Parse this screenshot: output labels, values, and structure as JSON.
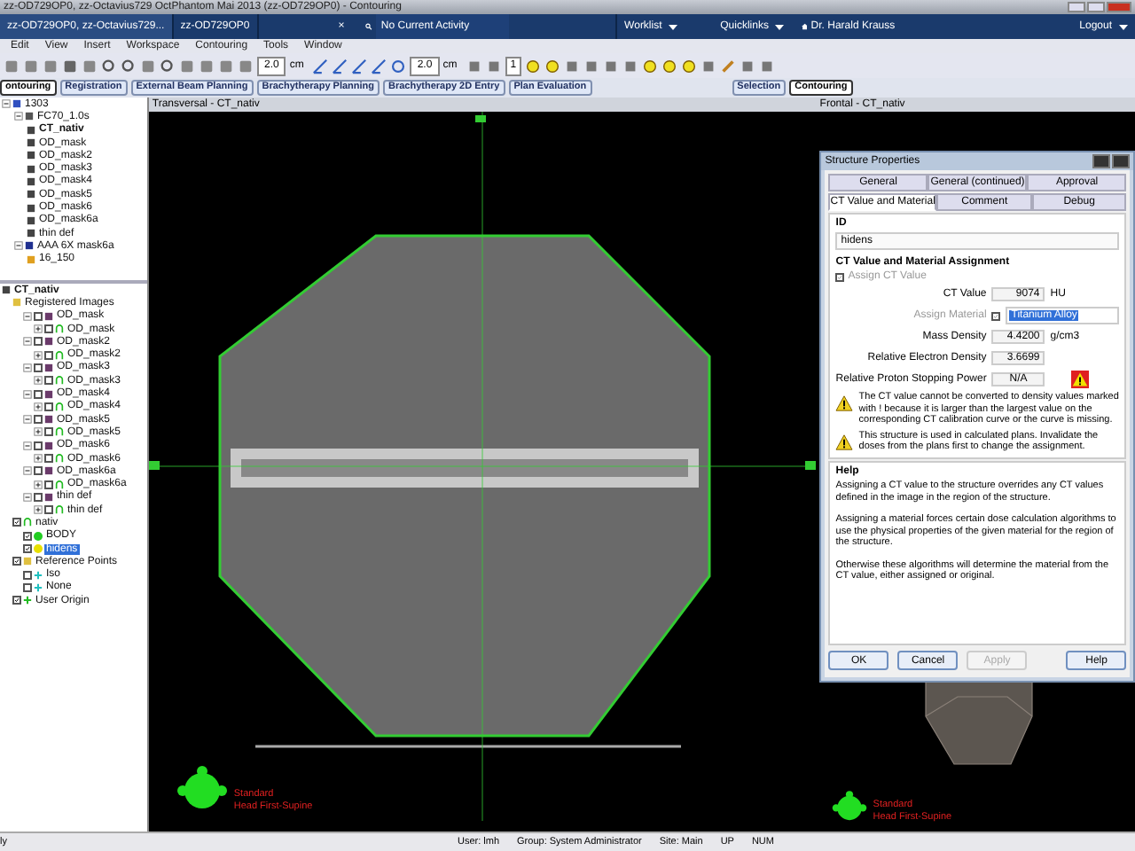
{
  "window": {
    "title": "zz-OD729OP0, zz-Octavius729 OctPhantom Mai 2013 (zz-OD729OP0) - Contouring"
  },
  "header_bar": {
    "tabs": [
      {
        "label": "zz-OD729OP0, zz-Octavius729...",
        "selected": true
      },
      {
        "label": "zz-OD729OP0",
        "selected": false
      }
    ],
    "close": "×",
    "activity": "No Current Activity",
    "worklist": "Worklist",
    "quicklinks": "Quicklinks",
    "user": "Dr. Harald Krauss",
    "logout": "Logout"
  },
  "menu": [
    "Edit",
    "View",
    "Insert",
    "Workspace",
    "Contouring",
    "Tools",
    "Window"
  ],
  "toolbar": {
    "fields": [
      {
        "value": "2.0",
        "unit": "cm"
      },
      {
        "value": "2.0",
        "unit": "cm"
      },
      {
        "value": "1"
      }
    ]
  },
  "workspaces": [
    {
      "label": "ontouring",
      "selected": true
    },
    {
      "label": "Registration",
      "selected": false
    },
    {
      "label": "External Beam Planning",
      "selected": false
    },
    {
      "label": "Brachytherapy Planning",
      "selected": false
    },
    {
      "label": "Brachytherapy 2D Entry",
      "selected": false
    },
    {
      "label": "Plan Evaluation",
      "selected": false
    }
  ],
  "modes": [
    {
      "label": "Selection",
      "selected": false
    },
    {
      "label": "Contouring",
      "selected": true
    }
  ],
  "scope_tree": [
    {
      "label": "1303",
      "kind": "study",
      "expanded": true,
      "children": [
        {
          "label": "FC70_1.0s",
          "kind": "series",
          "expanded": true,
          "children": [
            {
              "label": "CT_nativ",
              "kind": "image"
            },
            {
              "label": "OD_mask",
              "kind": "image"
            },
            {
              "label": "OD_mask2",
              "kind": "image"
            },
            {
              "label": "OD_mask3",
              "kind": "image"
            },
            {
              "label": "OD_mask4",
              "kind": "image"
            },
            {
              "label": "OD_mask5",
              "kind": "image"
            },
            {
              "label": "OD_mask6",
              "kind": "image"
            },
            {
              "label": "OD_mask6a",
              "kind": "image"
            },
            {
              "label": "thin def",
              "kind": "image"
            }
          ]
        },
        {
          "label": "AAA 6X mask6a",
          "kind": "plan",
          "expanded": true,
          "children": [
            {
              "label": "16_150",
              "kind": "dose"
            }
          ]
        }
      ]
    }
  ],
  "focus_tree": [
    {
      "label": "CT_nativ",
      "kind": "image",
      "selected": false,
      "children": [
        {
          "label": "Registered Images",
          "kind": "folder",
          "selected": false,
          "children": [
            {
              "label": "OD_mask",
              "kind": "image-set",
              "expanded": true,
              "checked": false,
              "selected": false,
              "children": [
                {
                  "label": "OD_mask",
                  "kind": "structure-set",
                  "expanded": false,
                  "checked": false,
                  "selected": false
                }
              ]
            },
            {
              "label": "OD_mask2",
              "kind": "image-set",
              "expanded": true,
              "checked": false,
              "selected": false,
              "children": [
                {
                  "label": "OD_mask2",
                  "kind": "structure-set",
                  "expanded": false,
                  "checked": false,
                  "selected": false
                }
              ]
            },
            {
              "label": "OD_mask3",
              "kind": "image-set",
              "expanded": true,
              "checked": false,
              "selected": false,
              "children": [
                {
                  "label": "OD_mask3",
                  "kind": "structure-set",
                  "expanded": false,
                  "checked": false,
                  "selected": false
                }
              ]
            },
            {
              "label": "OD_mask4",
              "kind": "image-set",
              "expanded": true,
              "checked": false,
              "selected": false,
              "children": [
                {
                  "label": "OD_mask4",
                  "kind": "structure-set",
                  "expanded": false,
                  "checked": false,
                  "selected": false
                }
              ]
            },
            {
              "label": "OD_mask5",
              "kind": "image-set",
              "expanded": true,
              "checked": false,
              "selected": false,
              "children": [
                {
                  "label": "OD_mask5",
                  "kind": "structure-set",
                  "expanded": false,
                  "checked": false,
                  "selected": false
                }
              ]
            },
            {
              "label": "OD_mask6",
              "kind": "image-set",
              "expanded": true,
              "checked": false,
              "selected": false,
              "children": [
                {
                  "label": "OD_mask6",
                  "kind": "structure-set",
                  "expanded": false,
                  "checked": false,
                  "selected": false
                }
              ]
            },
            {
              "label": "OD_mask6a",
              "kind": "image-set",
              "expanded": true,
              "checked": false,
              "selected": false,
              "children": [
                {
                  "label": "OD_mask6a",
                  "kind": "structure-set",
                  "expanded": false,
                  "checked": false,
                  "selected": false
                }
              ]
            },
            {
              "label": "thin def",
              "kind": "image-set",
              "expanded": true,
              "checked": false,
              "selected": false,
              "children": [
                {
                  "label": "thin def",
                  "kind": "structure-set",
                  "expanded": false,
                  "checked": false,
                  "selected": false
                }
              ]
            }
          ]
        },
        {
          "label": "nativ",
          "kind": "structure-set",
          "checked": true,
          "selected": false,
          "children": [
            {
              "label": "BODY",
              "kind": "structure",
              "checked": true,
              "selected": false,
              "color": "#22cc22"
            },
            {
              "label": "hidens",
              "kind": "structure",
              "checked": true,
              "selected": true,
              "color": "#e8e000"
            }
          ]
        },
        {
          "label": "Reference Points",
          "kind": "folder",
          "checked": true,
          "selected": false,
          "children": [
            {
              "label": "Iso",
              "kind": "point",
              "checked": false,
              "selected": false
            },
            {
              "label": "None",
              "kind": "point",
              "checked": false,
              "selected": false
            }
          ]
        },
        {
          "label": "User Origin",
          "kind": "origin",
          "checked": true,
          "selected": false
        }
      ]
    }
  ],
  "transversal": {
    "title": "Transversal - CT_nativ",
    "orientation": "Standard",
    "patient_position": "Head First-Supine"
  },
  "frontal": {
    "title": "Frontal - CT_nativ"
  },
  "view_3d": {
    "orientation": "Standard",
    "patient_position": "Head First-Supine"
  },
  "dialog": {
    "title": "Structure Properties",
    "tab_rows": [
      [
        {
          "label": "General",
          "selected": false
        },
        {
          "label": "General (continued)",
          "selected": false
        },
        {
          "label": "Approval",
          "selected": false
        }
      ],
      [
        {
          "label": "CT Value and Material",
          "selected": true
        },
        {
          "label": "Comment",
          "selected": false
        },
        {
          "label": "Debug",
          "selected": false
        }
      ]
    ],
    "id_label": "ID",
    "id_value": "hidens",
    "section": "CT Value and Material Assignment",
    "assign_ct": {
      "label": "Assign CT Value",
      "checked": true,
      "disabled": true
    },
    "ct_value": {
      "label": "CT Value",
      "value": "9074",
      "unit": "HU"
    },
    "assign_material": {
      "label": "Assign Material",
      "checked": true,
      "disabled": true,
      "value": "Titanium Alloy"
    },
    "mass_density": {
      "label": "Mass Density",
      "value": "4.4200",
      "unit": "g/cm3"
    },
    "electron_density": {
      "label": "Relative Electron Density",
      "value": "3.6699"
    },
    "proton_power": {
      "label": "Relative Proton Stopping Power",
      "value": "N/A"
    },
    "warnings": [
      "The CT value cannot be converted to density values marked with ! because it is larger than the largest value on the corresponding CT calibration curve or the curve is missing.",
      "This structure is used in calculated plans. Invalidate the doses from the plans first to change the assignment."
    ],
    "help_title": "Help",
    "help": [
      "Assigning a CT value to the structure overrides any CT values defined in the image in the region of the structure.",
      "Assigning a material forces certain dose calculation algorithms to use the physical properties of the given material for the region of the structure.",
      "Otherwise these algorithms will determine the material from the CT value, either assigned or original."
    ],
    "buttons": [
      {
        "label": "OK",
        "disabled": false
      },
      {
        "label": "Cancel",
        "disabled": false
      },
      {
        "label": "Apply",
        "disabled": true
      },
      {
        "label": "Help",
        "disabled": false
      }
    ]
  },
  "status_bar": [
    "ly",
    "User: lmh",
    "Group: System Administrator",
    "Site: Main",
    "UP",
    "NUM"
  ]
}
